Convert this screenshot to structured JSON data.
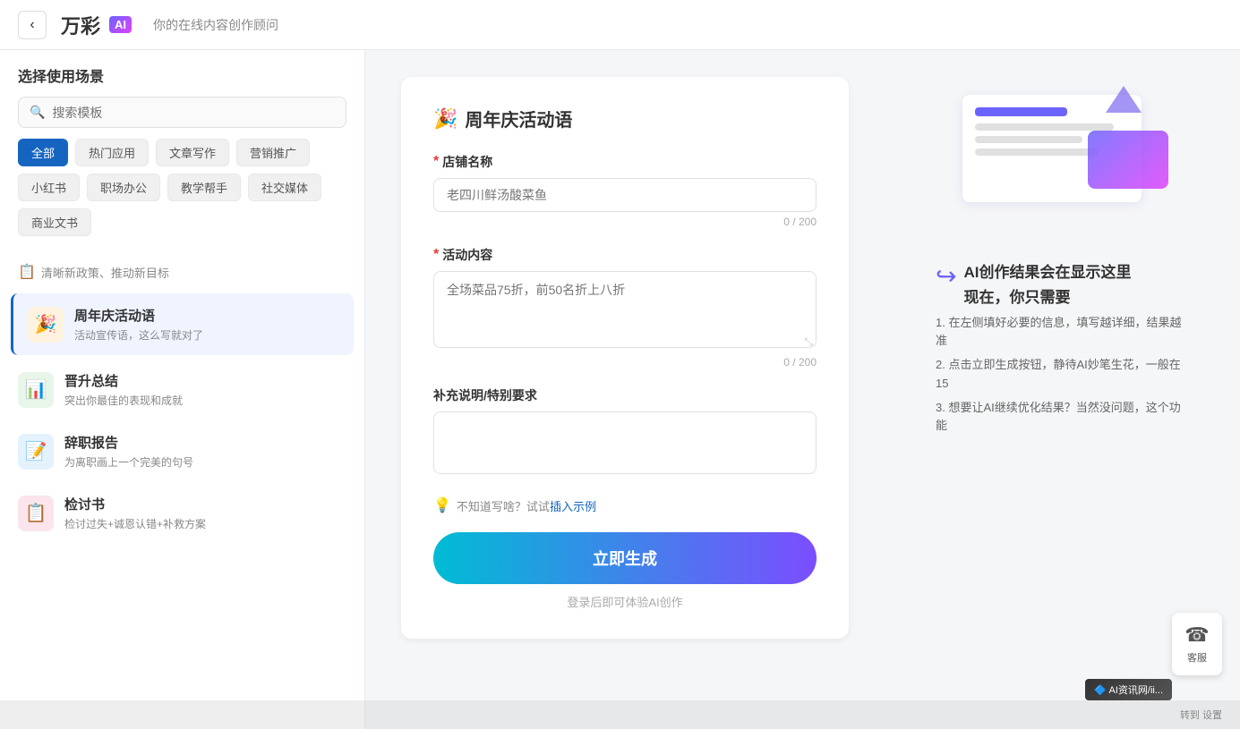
{
  "header": {
    "back_label": "←",
    "logo": "万彩",
    "logo_ai": "AI",
    "subtitle": "你的在线内容创作顾问"
  },
  "sidebar": {
    "title": "选择使用场景",
    "search_placeholder": "搜索模板",
    "tags": [
      {
        "label": "全部",
        "active": true
      },
      {
        "label": "热门应用",
        "active": false
      },
      {
        "label": "文章写作",
        "active": false
      },
      {
        "label": "营销推广",
        "active": false
      },
      {
        "label": "小红书",
        "active": false
      },
      {
        "label": "职场办公",
        "active": false
      },
      {
        "label": "教学帮手",
        "active": false
      },
      {
        "label": "社交媒体",
        "active": false
      },
      {
        "label": "商业文书",
        "active": false
      }
    ],
    "breadcrumb": {
      "icon": "📋",
      "label": "清晰新政策、推动新目标"
    },
    "items": [
      {
        "id": "anniversary",
        "icon": "🎉",
        "icon_bg": "party",
        "title": "周年庆活动语",
        "subtitle": "活动宣传语，这么写就对了",
        "active": true
      },
      {
        "id": "promotion",
        "icon": "📈",
        "icon_bg": "promo",
        "title": "晋升总结",
        "subtitle": "突出你最佳的表现和成就",
        "active": false
      },
      {
        "id": "resign",
        "icon": "📝",
        "icon_bg": "report",
        "title": "辞职报告",
        "subtitle": "为离职画上一个完美的句号",
        "active": false
      },
      {
        "id": "review",
        "icon": "📋",
        "icon_bg": "review",
        "title": "检讨书",
        "subtitle": "检讨过失+诚恩认错+补救方案",
        "active": false
      }
    ]
  },
  "form": {
    "title_icon": "🎉",
    "title": "周年庆活动语",
    "fields": [
      {
        "id": "store_name",
        "label": "店铺名称",
        "required": true,
        "placeholder": "老四川鲜汤酸菜鱼",
        "type": "input",
        "max_chars": 200,
        "current_chars": 0
      },
      {
        "id": "activity_content",
        "label": "活动内容",
        "required": true,
        "placeholder": "全场菜品75折，前50名折上八折",
        "type": "textarea",
        "max_chars": 200,
        "current_chars": 0
      },
      {
        "id": "supplement",
        "label": "补充说明/特别要求",
        "required": false,
        "placeholder": "",
        "type": "textarea",
        "max_chars": null,
        "current_chars": null
      }
    ],
    "hint": {
      "icon": "💡",
      "text": "不知道写啥？试试",
      "link": "插入示例"
    },
    "generate_button": "立即生成",
    "generate_hint": "登录后即可体验AI创作"
  },
  "ai_hint": {
    "title": "AI创作结果会在显示这里",
    "subtitle": "现在，你只需要",
    "steps": [
      "1. 在左侧填好必要的信息，填写越详细，结果越准",
      "2. 点击立即生成按钮，静待AI妙笔生花，一般在15",
      "3. 想要让AI继续优化结果？当然没问题，这个功能"
    ]
  },
  "customer_service": {
    "icon": "☎",
    "label": "客服"
  },
  "bottom_bar": {
    "text": "转到 设置"
  },
  "ai_badge": {
    "text": "AI资讯网/ii..."
  }
}
